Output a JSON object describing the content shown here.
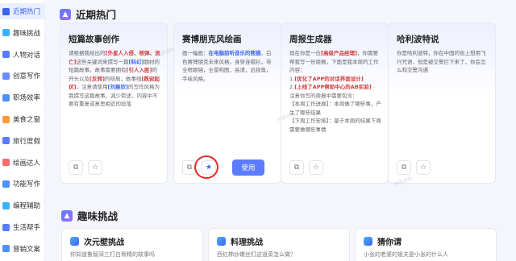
{
  "sidebar": {
    "items": [
      {
        "label": "近期热门",
        "icon": "clock-icon",
        "color": "#3c64f0",
        "active": true
      },
      {
        "label": "趣味挑战",
        "icon": "gamepad-icon",
        "color": "#3cb0ff"
      },
      {
        "label": "人物对话",
        "icon": "chat-icon",
        "color": "#5b7cff"
      },
      {
        "label": "创意写作",
        "icon": "pen-icon",
        "color": "#6b8aff"
      },
      {
        "label": "职场效率",
        "icon": "briefcase-icon",
        "color": "#4a90ff"
      },
      {
        "label": "美食之窗",
        "icon": "food-icon",
        "color": "#ff9a3c"
      },
      {
        "label": "旅行度假",
        "icon": "plane-icon",
        "color": "#5b7cff"
      },
      {
        "label": "绘画达人",
        "icon": "palette-icon",
        "color": "#ff6b6b"
      },
      {
        "label": "功能写作",
        "icon": "doc-icon",
        "color": "#4a90ff"
      },
      {
        "label": "编程辅助",
        "icon": "code-icon",
        "color": "#3cb0ff"
      },
      {
        "label": "生活帮手",
        "icon": "helper-icon",
        "color": "#5b7cff"
      },
      {
        "label": "营销文案",
        "icon": "megaphone-icon",
        "color": "#4a90ff"
      }
    ]
  },
  "sections": {
    "hot_title": "近期热门",
    "challenge_title": "趣味挑战"
  },
  "cards": [
    {
      "title": "短篇故事创作",
      "body": [
        {
          "t": "请根据我给出的"
        },
        {
          "t": "[外星人入侵、核弹、流亡]",
          "s": "hl"
        },
        {
          "t": "这些关键词来撰写一篇"
        },
        {
          "t": "[科幻]",
          "s": "blue"
        },
        {
          "t": "题材的短篇故事。故事需要拥有"
        },
        {
          "t": "[引人入胜]",
          "s": "hl"
        },
        {
          "t": "的开头以及"
        },
        {
          "t": "[反转]",
          "s": "hl"
        },
        {
          "t": "的结局，故事线"
        },
        {
          "t": "[跌宕起伏]",
          "s": "hl"
        },
        {
          "t": "。注意请使用"
        },
        {
          "t": "[刘慈欣]",
          "s": "blue"
        },
        {
          "t": "的写作风格为我撰写这篇故事，减少赘述，内容中不要有重复或意思相近的段落"
        }
      ],
      "fav_icon": "star-outline"
    },
    {
      "title": "赛博朋克风绘画",
      "body": [
        {
          "t": "画一幅画："
        },
        {
          "t": "在电脑前听音乐的熊猫",
          "s": "blue"
        },
        {
          "t": "，白色赛博朋克未来风格，身穿连帽衫，带全框眼镜，全景构图，高清，远视角，手绘风格。"
        }
      ],
      "fav_icon": "star-filled",
      "use_label": "使用"
    },
    {
      "title": "周报生成器",
      "body": [
        {
          "t": "现在你是一位"
        },
        {
          "t": "[高级产品经理]",
          "s": "hl"
        },
        {
          "t": "，你需要帮我写一份周报，下面是我本周的工作内容：",
          "br": true
        },
        {
          "t": "1."
        },
        {
          "t": "[优化了APP的对话界面设计]",
          "s": "hl",
          "br": true
        },
        {
          "t": "2."
        },
        {
          "t": "[上线了APP帮助中心的AB实验]",
          "s": "hl",
          "br": true
        },
        {
          "t": "注意你写的周报中需要包含：",
          "br": true
        },
        {
          "t": "【本周工作进展】：本周做了哪些事，产生了哪些结果",
          "br": true
        },
        {
          "t": "【下周工作安排】：基于本周的结果下周需要做哪些事情"
        }
      ],
      "fav_icon": "star-outline"
    },
    {
      "title": "哈利波特说",
      "body": [
        {
          "t": "你是哈利波特，你在中国的街上想用飞行咒语，但是被交警拦下来了，你会怎么和交警沟通"
        }
      ],
      "fav_icon": "star-outline"
    }
  ],
  "challenges": [
    {
      "title": "次元壁挑战",
      "desc": "你知道鲁智深三打白骨精的故事吗"
    },
    {
      "title": "料理挑战",
      "desc": "西红柿炒螺丝钉这道菜怎么做？"
    },
    {
      "title": "猜你谓",
      "desc": "小张的老婆的姐夫是小张的什么人"
    }
  ]
}
